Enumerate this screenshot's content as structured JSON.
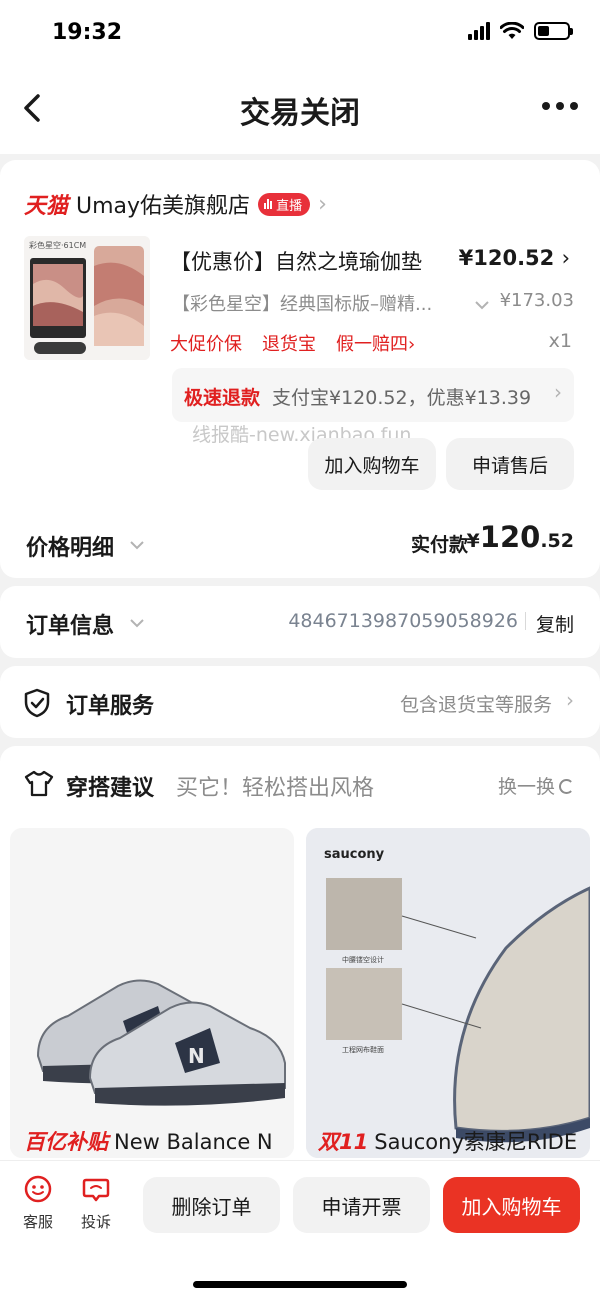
{
  "status_bar": {
    "time": "19:32"
  },
  "nav": {
    "title": "交易关闭"
  },
  "order": {
    "platform": "天猫",
    "shop_name": "Umay佑美旗舰店",
    "live_label": "直播",
    "product_title": "【优惠价】自然之境瑜伽垫",
    "price": "¥120.52",
    "spec": "【彩色星空】经典国标版–赠精...",
    "original_price": "¥173.03",
    "promo_tags": [
      "大促价保",
      "退货宝",
      "假一赔四"
    ],
    "promo_tag_arrow": "›",
    "quantity": "x1",
    "refund_label": "极速退款",
    "refund_detail": "支付宝¥120.52，优惠¥13.39",
    "watermark": "线报酷-new.xianbao.fun",
    "btn_add_cart": "加入购物车",
    "btn_after_sale": "申请售后",
    "price_detail_label": "价格明细",
    "paid_label": "实付款",
    "paid_currency": "¥",
    "paid_int": "120",
    "paid_dec": ".52",
    "image_caption": "彩色星空·61CM"
  },
  "order_info": {
    "label": "订单信息",
    "number": "4846713987059058926",
    "copy_label": "复制"
  },
  "order_service": {
    "label": "订单服务",
    "value": "包含退货宝等服务"
  },
  "outfit": {
    "title": "穿搭建议",
    "subtitle": "买它！轻松搭出风格",
    "refresh_label": "换一换",
    "items": [
      {
        "badge": "百亿补贴",
        "name": "New Balance N"
      },
      {
        "badge": "双11",
        "name": "Saucony索康尼RIDE",
        "brand_logo": "saucony",
        "caption_top": "中腰镂空设计",
        "caption_bottom": "工程网布鞋面"
      }
    ]
  },
  "bottom_bar": {
    "service_label": "客服",
    "complain_label": "投诉",
    "delete_label": "删除订单",
    "invoice_label": "申请开票",
    "cart_label": "加入购物车"
  },
  "colors": {
    "accent_red": "#e02020",
    "button_red": "#ea3324"
  }
}
